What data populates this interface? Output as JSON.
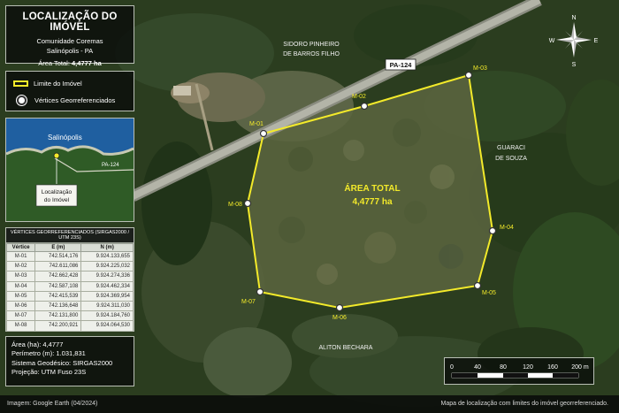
{
  "title": {
    "main": "LOCALIZAÇÃO DO IMÓVEL",
    "community": "Comunidade Coremas",
    "city": "Salinópolis - PA",
    "area_label": "Área Total:",
    "area_value": "4,4777 ha"
  },
  "legend": {
    "boundary": "Limite do Imóvel",
    "vertices": "Vértices Georreferenciados"
  },
  "inset": {
    "city": "Salinópolis",
    "road": "PA-124",
    "location_line1": "Localização",
    "location_line2": "do Imóvel"
  },
  "table": {
    "title": "VÉRTICES GEORREFERENCIADOS (SIRGAS2000 / UTM 23S)",
    "headers": [
      "Vértice",
      "E (m)",
      "N (m)"
    ],
    "rows": [
      [
        "M-01",
        "742.514,176",
        "9.924.133,655"
      ],
      [
        "M-02",
        "742.611,086",
        "9.924.225,032"
      ],
      [
        "M-03",
        "742.662,428",
        "9.924.274,336"
      ],
      [
        "M-04",
        "742.587,108",
        "9.924.462,334"
      ],
      [
        "M-05",
        "742.415,539",
        "9.924.369,954"
      ],
      [
        "M-06",
        "742.136,648",
        "9.924.311,030"
      ],
      [
        "M-07",
        "742.131,800",
        "9.924.184,760"
      ],
      [
        "M-08",
        "742.200,921",
        "9.924.064,530"
      ]
    ]
  },
  "info": {
    "area": "Área (ha): 4,4777",
    "perimeter": "Perímetro (m): 1.031,831",
    "geodetic": "Sistema Geodésico: SIRGAS2000",
    "projection": "Projeção: UTM Fuso 23S"
  },
  "map": {
    "road_label": "PA-124",
    "neighbor_north_1": "SIDORO PINHEIRO",
    "neighbor_north_2": "DE BARROS FILHO",
    "neighbor_east_1": "GUARACI",
    "neighbor_east_2": "DE SOUZA",
    "neighbor_south": "ALITON BECHARA",
    "area_title": "ÁREA TOTAL",
    "area_value": "4,4777 ha",
    "vertices": [
      "M-01",
      "M-02",
      "M-03",
      "M-04",
      "M-05",
      "M-06",
      "M-07",
      "M-08"
    ],
    "boundary_color": "#f3ea2a"
  },
  "compass": {
    "n": "N",
    "s": "S",
    "e": "E",
    "w": "W"
  },
  "scale": {
    "ticks": [
      "0",
      "40",
      "80",
      "120",
      "160",
      "200 m"
    ]
  },
  "footer": {
    "source": "Imagem: Google Earth (04/2024)",
    "caption": "Mapa de localização com limites do imóvel georreferenciado."
  }
}
